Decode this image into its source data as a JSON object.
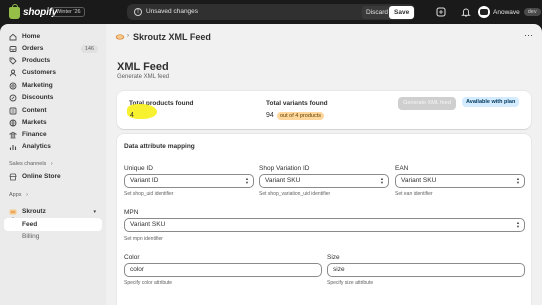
{
  "topbar": {
    "logo_text": "shopify",
    "edition": "Winter '26",
    "unsaved_text": "Unsaved changes",
    "discard_label": "Discard",
    "save_label": "Save",
    "account_name": "Anowave",
    "account_badge": "dev"
  },
  "sidebar": {
    "items": [
      {
        "label": "Home",
        "icon": "home-icon"
      },
      {
        "label": "Orders",
        "icon": "orders-icon",
        "count": "146"
      },
      {
        "label": "Products",
        "icon": "tag-icon"
      },
      {
        "label": "Customers",
        "icon": "person-icon"
      },
      {
        "label": "Marketing",
        "icon": "target-icon"
      },
      {
        "label": "Discounts",
        "icon": "discount-icon"
      },
      {
        "label": "Content",
        "icon": "content-icon"
      },
      {
        "label": "Markets",
        "icon": "globe-icon"
      },
      {
        "label": "Finance",
        "icon": "bank-icon"
      },
      {
        "label": "Analytics",
        "icon": "chart-icon"
      }
    ],
    "sales_channels_header": "Sales channels",
    "online_store": "Online Store",
    "apps_header": "Apps",
    "app_name": "Skroutz",
    "feed_label": "Feed",
    "billing_label": "Billing"
  },
  "app_header": {
    "title": "Skroutz XML Feed"
  },
  "page": {
    "title": "XML Feed",
    "subtitle": "Generate XML feed"
  },
  "summary": {
    "products_label": "Total products found",
    "products_value": "4",
    "variants_label": "Total variants found",
    "variants_value": "94",
    "variants_badge": "out of 4 products",
    "generate_label": "Generate XML feed",
    "plan_badge": "Available with plan"
  },
  "mapping": {
    "title": "Data attribute mapping",
    "unique_id": {
      "label": "Unique ID",
      "value": "Variant ID",
      "help": "Set shop_uid identifier"
    },
    "shop_variation_id": {
      "label": "Shop Variation ID",
      "value": "Variant SKU",
      "help": "Set shop_variation_uid identifier"
    },
    "ean": {
      "label": "EAN",
      "value": "Variant SKU",
      "help": "Set ean identifier"
    },
    "mpn": {
      "label": "MPN",
      "value": "Variant SKU",
      "help": "Set mpn identifier"
    },
    "color": {
      "label": "Color",
      "value": "color",
      "help": "Specify color attribute"
    },
    "size": {
      "label": "Size",
      "value": "size",
      "help": "Specify size attribute"
    }
  },
  "colors": {
    "topbar": "#1a1a1a",
    "highlight": "#f7f025",
    "plan_badge": "#d5ebff",
    "warn_badge": "#ffd79d"
  }
}
